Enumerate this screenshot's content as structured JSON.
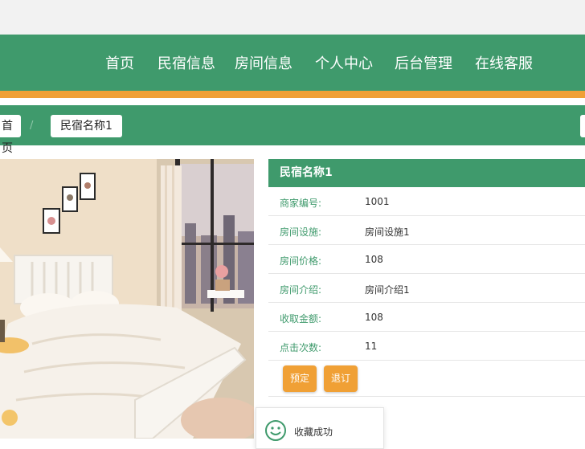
{
  "nav": {
    "items": [
      {
        "label": "首页"
      },
      {
        "label": "民宿信息"
      },
      {
        "label": "房间信息"
      },
      {
        "label": "个人中心"
      },
      {
        "label": "后台管理"
      },
      {
        "label": "在线客服"
      }
    ]
  },
  "breadcrumb": {
    "home": "首页",
    "separator": "/",
    "current": "民宿名称1"
  },
  "detail": {
    "title": "民宿名称1",
    "fields": [
      {
        "label": "商家编号:",
        "value": "1001"
      },
      {
        "label": "房间设施:",
        "value": "房间设施1"
      },
      {
        "label": "房间价格:",
        "value": "108"
      },
      {
        "label": "房间介绍:",
        "value": "房间介绍1"
      },
      {
        "label": "收取金额:",
        "value": "108"
      },
      {
        "label": "点击次数:",
        "value": "11"
      }
    ],
    "buttons": {
      "book": "预定",
      "unfavorite": "退订"
    }
  },
  "toast": {
    "text": "收藏成功",
    "icon": "smile-icon"
  },
  "colors": {
    "primary": "#3f9a6c",
    "accent": "#f0a035",
    "label": "#3f9a6c"
  }
}
